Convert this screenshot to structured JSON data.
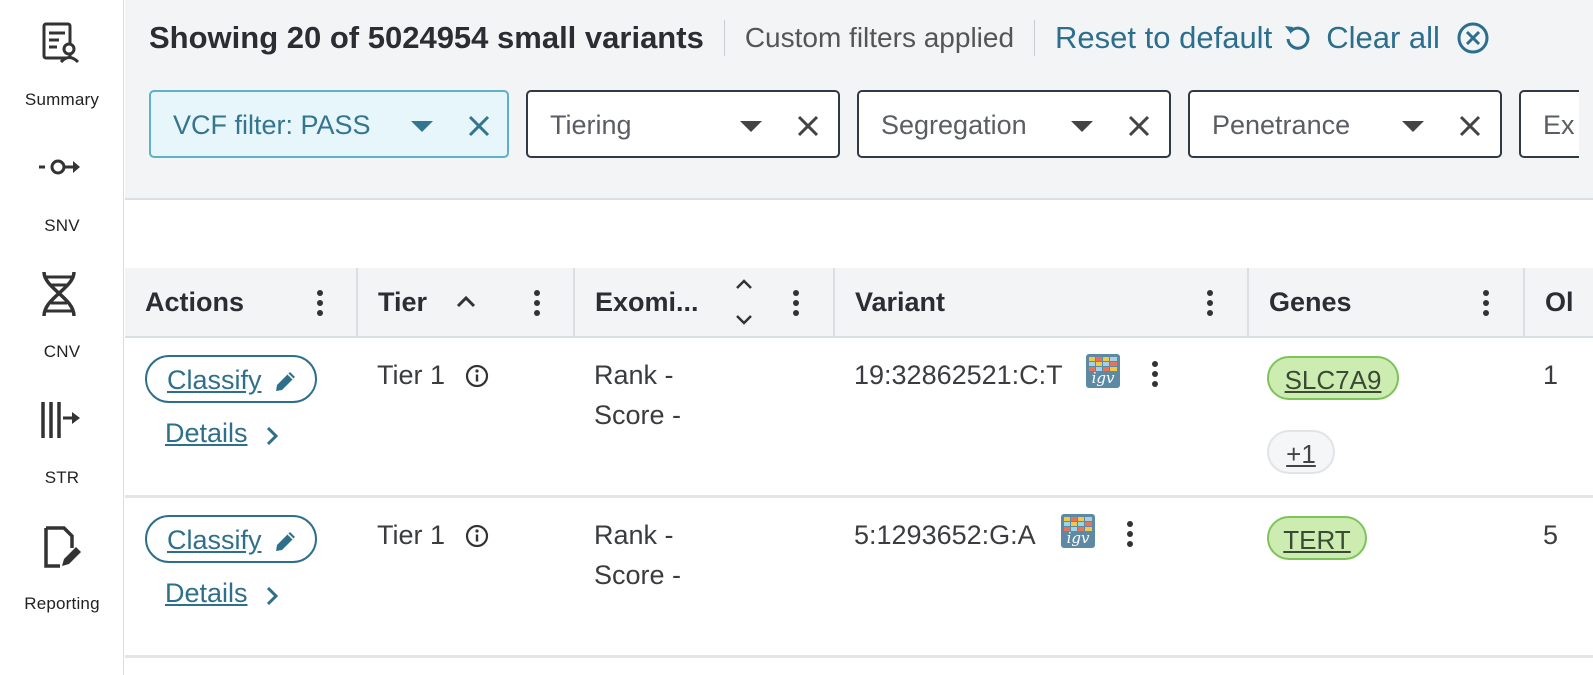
{
  "sidebar": {
    "items": [
      {
        "label": "Summary",
        "icon": "summary-icon"
      },
      {
        "label": "SNV",
        "icon": "snv-icon"
      },
      {
        "label": "CNV",
        "icon": "dna-icon"
      },
      {
        "label": "STR",
        "icon": "str-icon"
      },
      {
        "label": "Reporting",
        "icon": "report-edit-icon"
      }
    ]
  },
  "header": {
    "summary": "Showing 20 of 5024954 small variants",
    "custom_filters": "Custom filters applied",
    "reset_label": "Reset to default",
    "clear_label": "Clear all"
  },
  "filters": [
    {
      "label": "VCF filter: PASS",
      "active": true
    },
    {
      "label": "Tiering",
      "active": false
    },
    {
      "label": "Segregation",
      "active": false
    },
    {
      "label": "Penetrance",
      "active": false
    },
    {
      "label": "Ex",
      "active": false
    }
  ],
  "table": {
    "columns": [
      "Actions",
      "Tier",
      "Exomi...",
      "Variant",
      "Genes",
      "Ol"
    ],
    "rows": [
      {
        "classify": "Classify",
        "details": "Details",
        "tier": "Tier 1",
        "rank": "Rank -",
        "score": "Score -",
        "variant": "19:32862521:C:T",
        "gene": "SLC7A9",
        "more_genes": "+1",
        "extra": "1"
      },
      {
        "classify": "Classify",
        "details": "Details",
        "tier": "Tier 1",
        "rank": "Rank -",
        "score": "Score -",
        "variant": "5:1293652:G:A",
        "gene": "TERT",
        "extra": "5"
      }
    ],
    "igv_label": "igv"
  },
  "colors": {
    "accent": "#2e6f8c",
    "active_filter_bg": "#e6f6fa",
    "gene_chip_bg": "#cdecb2",
    "header_bg": "#f2f4f5"
  }
}
